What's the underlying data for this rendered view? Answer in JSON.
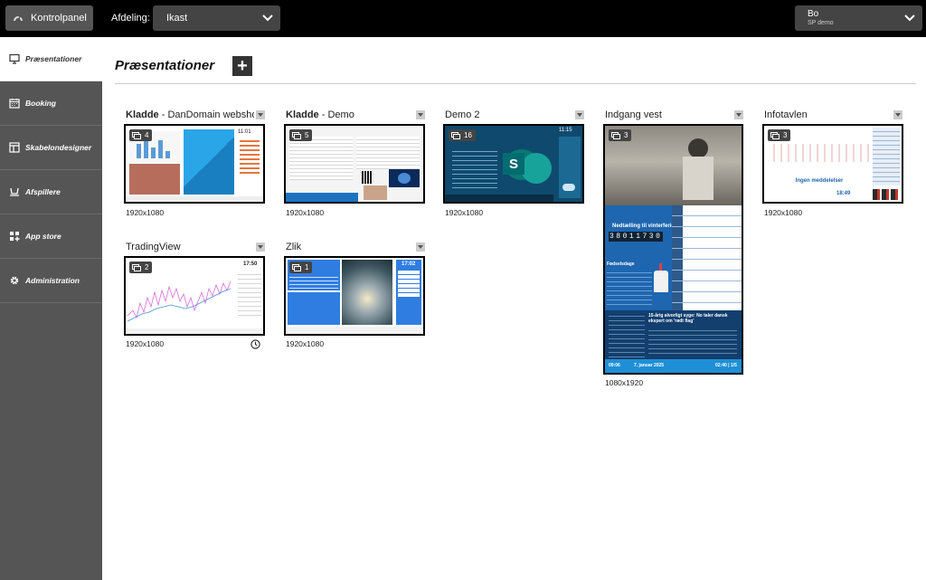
{
  "topbar": {
    "dashboard_label": "Kontrolpanel",
    "department_label": "Afdeling:",
    "department_value": "Ikast",
    "user_name": "Bo",
    "user_sub": "SP demo"
  },
  "sidebar": {
    "items": [
      {
        "label": "Præsentationer",
        "icon": "monitor-icon",
        "active": true
      },
      {
        "label": "Booking",
        "icon": "calendar-icon"
      },
      {
        "label": "Skabelondesigner",
        "icon": "template-icon"
      },
      {
        "label": "Afspillere",
        "icon": "player-icon"
      },
      {
        "label": "App store",
        "icon": "apps-icon"
      },
      {
        "label": "Administration",
        "icon": "gear-icon"
      }
    ]
  },
  "main": {
    "title": "Præsentationer",
    "add_label": "+"
  },
  "cards": [
    {
      "prefix": "Kladde",
      "title": " - DanDomain webshop st...",
      "count": "4",
      "resolution": "1920x1080"
    },
    {
      "prefix": "Kladde",
      "title": " - Demo",
      "count": "5",
      "resolution": "1920x1080"
    },
    {
      "prefix": "",
      "title": "Demo 2",
      "count": "16",
      "resolution": "1920x1080"
    },
    {
      "prefix": "",
      "title": "Indgang vest",
      "count": "3",
      "resolution": "1080x1920"
    },
    {
      "prefix": "",
      "title": "Infotavlen",
      "count": "3",
      "resolution": "1920x1080"
    },
    {
      "prefix": "",
      "title": "TradingView",
      "count": "2",
      "resolution": "1920x1080"
    },
    {
      "prefix": "",
      "title": "Zlik",
      "count": "1",
      "resolution": "1920x1080"
    }
  ],
  "thumb_text": {
    "t1_time": "11:01",
    "t3_time": "11:15",
    "t3_sharepoint": "S",
    "t4_heading": "Nedtælling til vinterferie!",
    "t4_digits": "38011730",
    "t4_section": "Fødselsdage",
    "t4_news": "15-årig alvorligt syge: No taler dansk ekspert om 'rødt flag'",
    "t4_footer_time": "09:06",
    "t4_footer_date": "7. januar 2025",
    "t4_footer_page": "02:40 | 1/5",
    "t5_caption": "Ingen meddelelser",
    "t5_time": "18:49",
    "t6_time": "17:50",
    "t7_time": "17:02"
  },
  "colors": {
    "topbar": "#000000",
    "sidebar": "#555555",
    "accent_blue": "#1e73be"
  }
}
